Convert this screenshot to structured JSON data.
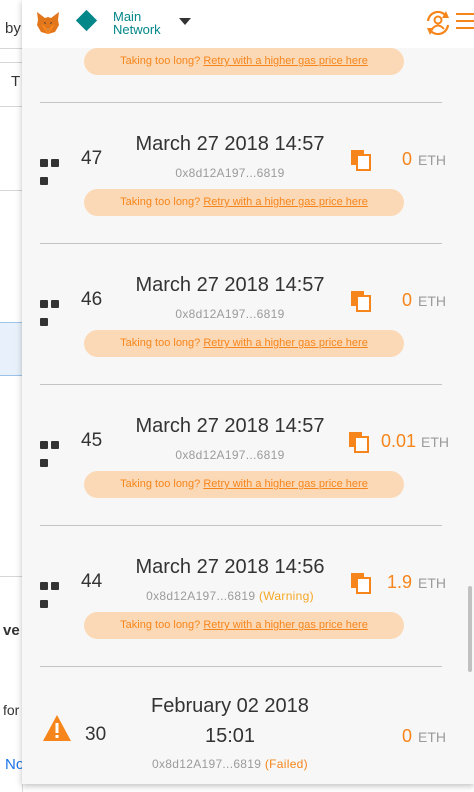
{
  "header": {
    "network_line1": "Main",
    "network_line2": "Network",
    "network_color": "#038789",
    "accent_color": "#f6851b"
  },
  "background_page": {
    "fragments": [
      "by",
      "T",
      "ve",
      "for",
      "No"
    ]
  },
  "retry": {
    "prefix": "Taking too long?",
    "link": "Retry with a higher gas price here"
  },
  "transactions": [
    {
      "status": "pending",
      "nonce": "47",
      "date": "March 27 2018 14:57",
      "address": "0x8d12A197...6819",
      "amount": "0",
      "currency": "ETH"
    },
    {
      "status": "pending",
      "nonce": "46",
      "date": "March 27 2018 14:57",
      "address": "0x8d12A197...6819",
      "amount": "0",
      "currency": "ETH"
    },
    {
      "status": "pending",
      "nonce": "45",
      "date": "March 27 2018 14:57",
      "address": "0x8d12A197...6819",
      "amount": "0.01",
      "currency": "ETH"
    },
    {
      "status": "pending",
      "nonce": "44",
      "date": "March 27 2018 14:56",
      "address": "0x8d12A197...6819",
      "tag": "(Warning)",
      "amount": "1.9",
      "currency": "ETH"
    },
    {
      "status": "failed",
      "nonce": "30",
      "date_line1": "February 02 2018",
      "date_line2": "15:01",
      "address": "0x8d12A197...6819",
      "tag": "(Failed)",
      "amount": "0",
      "currency": "ETH"
    }
  ]
}
